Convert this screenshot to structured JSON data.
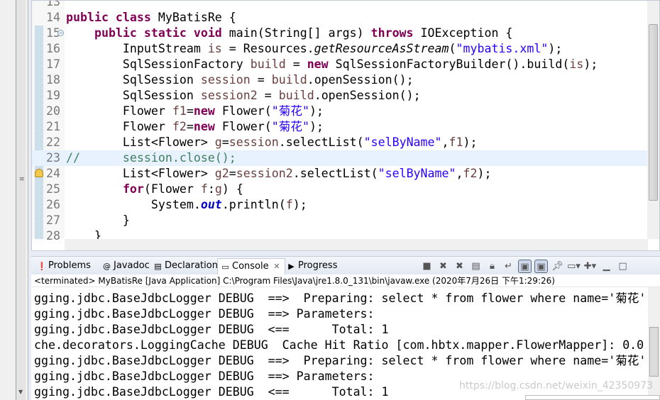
{
  "editor": {
    "lines": [
      {
        "n": "13",
        "tokens": []
      },
      {
        "n": "14",
        "tokens": [
          [
            "public class",
            "kw"
          ],
          [
            " MyBatisRe {",
            ""
          ]
        ]
      },
      {
        "n": "15",
        "fold": true,
        "tokens": [
          [
            "    ",
            ""
          ],
          [
            "public static void",
            "kw"
          ],
          [
            " main(String[] args) ",
            ""
          ],
          [
            "throws",
            "kw"
          ],
          [
            " IOException {",
            ""
          ]
        ]
      },
      {
        "n": "16",
        "tokens": [
          [
            "        InputStream ",
            ""
          ],
          [
            "is",
            "var"
          ],
          [
            " = Resources.",
            ""
          ],
          [
            "getResourceAsStream",
            "sm"
          ],
          [
            "(",
            ""
          ],
          [
            "\"mybatis.xml\"",
            "str"
          ],
          [
            ");",
            ""
          ]
        ]
      },
      {
        "n": "17",
        "tokens": [
          [
            "        SqlSessionFactory ",
            ""
          ],
          [
            "build",
            "var"
          ],
          [
            " = ",
            ""
          ],
          [
            "new",
            "kw"
          ],
          [
            " SqlSessionFactoryBuilder().build(",
            ""
          ],
          [
            "is",
            "var"
          ],
          [
            ");",
            ""
          ]
        ]
      },
      {
        "n": "18",
        "tokens": [
          [
            "        SqlSession ",
            ""
          ],
          [
            "session",
            "var"
          ],
          [
            " = ",
            ""
          ],
          [
            "build",
            "var"
          ],
          [
            ".openSession();",
            ""
          ]
        ]
      },
      {
        "n": "19",
        "tokens": [
          [
            "        SqlSession ",
            ""
          ],
          [
            "session2",
            "var"
          ],
          [
            " = ",
            ""
          ],
          [
            "build",
            "var"
          ],
          [
            ".openSession();",
            ""
          ]
        ]
      },
      {
        "n": "20",
        "tokens": [
          [
            "        Flower ",
            ""
          ],
          [
            "f1",
            "var"
          ],
          [
            "=",
            ""
          ],
          [
            "new",
            "kw"
          ],
          [
            " Flower(",
            ""
          ],
          [
            "\"菊花\"",
            "str"
          ],
          [
            ");",
            ""
          ]
        ]
      },
      {
        "n": "21",
        "tokens": [
          [
            "        Flower ",
            ""
          ],
          [
            "f2",
            "var"
          ],
          [
            "=",
            ""
          ],
          [
            "new",
            "kw"
          ],
          [
            " Flower(",
            ""
          ],
          [
            "\"菊花\"",
            "str"
          ],
          [
            ");",
            ""
          ]
        ]
      },
      {
        "n": "22",
        "tokens": [
          [
            "        List<Flower> ",
            ""
          ],
          [
            "g",
            "var"
          ],
          [
            "=",
            ""
          ],
          [
            "session",
            "var"
          ],
          [
            ".selectList(",
            ""
          ],
          [
            "\"selByName\"",
            "str"
          ],
          [
            ",",
            ""
          ],
          [
            "f1",
            "var"
          ],
          [
            ");",
            ""
          ]
        ]
      },
      {
        "n": "23",
        "highlight": true,
        "tokens": [
          [
            "//      session.close();",
            "cm"
          ]
        ]
      },
      {
        "n": "24",
        "warning": true,
        "tokens": [
          [
            "        List<Flower> ",
            ""
          ],
          [
            "g2",
            "var"
          ],
          [
            "=",
            ""
          ],
          [
            "session2",
            "var"
          ],
          [
            ".selectList(",
            ""
          ],
          [
            "\"selByName\"",
            "str"
          ],
          [
            ",",
            ""
          ],
          [
            "f2",
            "var"
          ],
          [
            ");",
            ""
          ]
        ]
      },
      {
        "n": "25",
        "tokens": [
          [
            "        ",
            ""
          ],
          [
            "for",
            "kw"
          ],
          [
            "(Flower ",
            ""
          ],
          [
            "f",
            "var"
          ],
          [
            ":",
            ""
          ],
          [
            "g",
            "var"
          ],
          [
            ") {",
            ""
          ]
        ]
      },
      {
        "n": "26",
        "tokens": [
          [
            "            System.",
            ""
          ],
          [
            "out",
            "fld"
          ],
          [
            ".println(",
            ""
          ],
          [
            "f",
            "var"
          ],
          [
            ");",
            ""
          ]
        ]
      },
      {
        "n": "27",
        "tokens": [
          [
            "        }",
            ""
          ]
        ]
      },
      {
        "n": "28",
        "tokens": [
          [
            "    }",
            ""
          ]
        ]
      }
    ]
  },
  "tabs": [
    {
      "label": "Problems",
      "icon": "problems-icon"
    },
    {
      "label": "Javadoc",
      "icon": "at-icon"
    },
    {
      "label": "Declaration",
      "icon": "declaration-icon"
    },
    {
      "label": "Console",
      "icon": "console-icon",
      "active": true
    },
    {
      "label": "Progress",
      "icon": "progress-icon"
    }
  ],
  "console": {
    "status": "<terminated> MyBatisRe [Java Application] C:\\Program Files\\Java\\jre1.8.0_131\\bin\\javaw.exe (2020年7月26日 下午1:29:26)",
    "lines": [
      "gging.jdbc.BaseJdbcLogger DEBUG  ==>  Preparing: select * from flower where name='菊花'",
      "gging.jdbc.BaseJdbcLogger DEBUG  ==> Parameters: ",
      "gging.jdbc.BaseJdbcLogger DEBUG  <==      Total: 1",
      "che.decorators.LoggingCache DEBUG  Cache Hit Ratio [com.hbtx.mapper.FlowerMapper]: 0.0",
      "gging.jdbc.BaseJdbcLogger DEBUG  ==>  Preparing: select * from flower where name='菊花'",
      "gging.jdbc.BaseJdbcLogger DEBUG  ==> Parameters: ",
      "gging.jdbc.BaseJdbcLogger DEBUG  <==      Total: 1"
    ],
    "watermark": "https://blog.csdn.net/weixin_42350973"
  },
  "colors": {
    "keyword": "#7f0055",
    "string": "#2a00ff",
    "comment": "#3f7f5f",
    "field": "#0000c0",
    "local": "#6a3e3e"
  }
}
